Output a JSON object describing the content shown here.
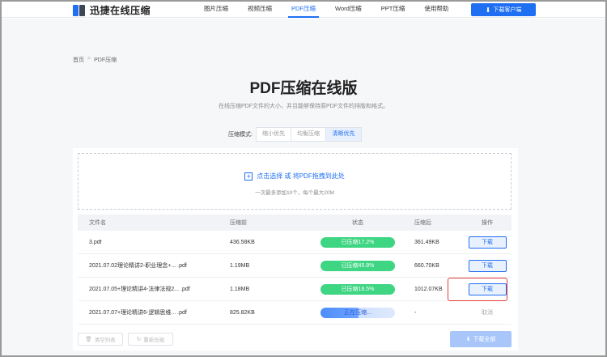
{
  "header": {
    "logo_text": "迅捷在线压缩",
    "nav": [
      "图片压缩",
      "视频压缩",
      "PDF压缩",
      "Word压缩",
      "PPT压缩",
      "使用帮助"
    ],
    "active_nav": "PDF压缩",
    "download_client": "下载客户端"
  },
  "breadcrumb": {
    "home": "首页",
    "sep": ">",
    "current": "PDF压缩"
  },
  "page": {
    "title": "PDF压缩在线版",
    "subtitle": "在线压缩PDF文件的大小，并且能够保持原PDF文件的排版和格式。"
  },
  "mode": {
    "label": "压缩模式:",
    "options": [
      "缩小优先",
      "均衡压缩",
      "清晰优先"
    ],
    "selected": "清晰优先"
  },
  "upload": {
    "plus": "+",
    "main_text": "点击选择 或 将PDF拖拽到此处",
    "sub_text": "一次最多添加10个，每个最大20M"
  },
  "table": {
    "headers": {
      "name": "文件名",
      "before": "压缩前",
      "status": "状态",
      "after": "压缩后",
      "op": "操作"
    },
    "rows": [
      {
        "name": "3.pdf",
        "before": "436.58KB",
        "status": "已压缩17.2%",
        "after": "361.49KB",
        "op": "下载"
      },
      {
        "name": "2021.07.02理论精讲2-职业理念+... .pdf",
        "before": "1.19MB",
        "status": "已压缩45.8%",
        "after": "660.70KB",
        "op": "下载"
      },
      {
        "name": "2021.07.05+理论精讲4-法律法规2... .pdf",
        "before": "1.18MB",
        "status": "已压缩16.5%",
        "after": "1012.07KB",
        "op": "下载"
      },
      {
        "name": "2021.07.07+理论精讲6-逻辑思维... .pdf",
        "before": "825.82KB",
        "status": "正在压缩...",
        "after": "-",
        "op": "取消"
      }
    ]
  },
  "actions": {
    "clear": "清空列表",
    "recompress": "重新压缩",
    "download_all": "下载全部"
  },
  "colors": {
    "accent": "#1f6ff2",
    "success": "#3ed583",
    "highlight": "#e43b3b"
  }
}
